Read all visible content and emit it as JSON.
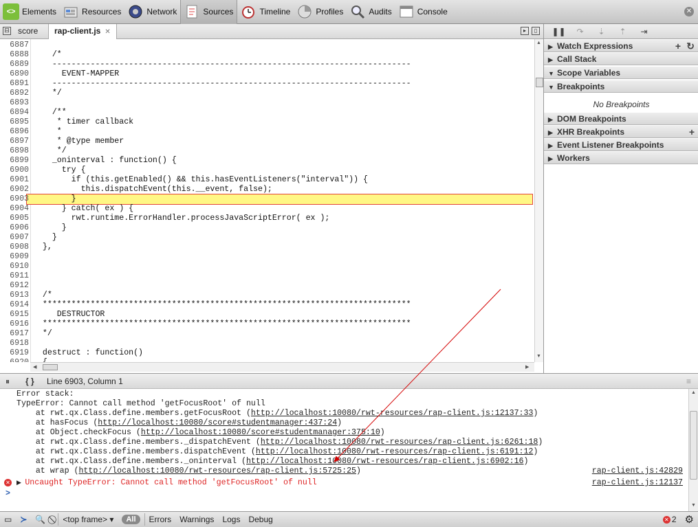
{
  "toolbar": {
    "items": [
      {
        "label": "Elements",
        "icon": "elements-icon"
      },
      {
        "label": "Resources",
        "icon": "resources-icon"
      },
      {
        "label": "Network",
        "icon": "network-icon"
      },
      {
        "label": "Sources",
        "icon": "sources-icon",
        "active": true
      },
      {
        "label": "Timeline",
        "icon": "timeline-icon"
      },
      {
        "label": "Profiles",
        "icon": "profiles-icon"
      },
      {
        "label": "Audits",
        "icon": "audits-icon"
      },
      {
        "label": "Console",
        "icon": "console-icon"
      }
    ]
  },
  "editor": {
    "tabs": [
      "score",
      "rap-client.js"
    ],
    "active_tab": "rap-client.js",
    "highlight_line": "6903",
    "lines": [
      {
        "n": "6887",
        "t": ""
      },
      {
        "n": "6888",
        "t": "    /*"
      },
      {
        "n": "6889",
        "t": "    ---------------------------------------------------------------------------"
      },
      {
        "n": "6890",
        "t": "      EVENT-MAPPER"
      },
      {
        "n": "6891",
        "t": "    ---------------------------------------------------------------------------"
      },
      {
        "n": "6892",
        "t": "    */"
      },
      {
        "n": "6893",
        "t": ""
      },
      {
        "n": "6894",
        "t": "    /**"
      },
      {
        "n": "6895",
        "t": "     * timer callback"
      },
      {
        "n": "6896",
        "t": "     *"
      },
      {
        "n": "6897",
        "t": "     * @type member"
      },
      {
        "n": "6898",
        "t": "     */"
      },
      {
        "n": "6899",
        "t": "    _oninterval : function() {"
      },
      {
        "n": "6900",
        "t": "      try {"
      },
      {
        "n": "6901",
        "t": "        if (this.getEnabled() && this.hasEventListeners(\"interval\")) {"
      },
      {
        "n": "6902",
        "t": "          this.dispatchEvent(this.__event, false);"
      },
      {
        "n": "6903",
        "t": "        }"
      },
      {
        "n": "6904",
        "t": "      } catch( ex ) {"
      },
      {
        "n": "6905",
        "t": "        rwt.runtime.ErrorHandler.processJavaScriptError( ex );"
      },
      {
        "n": "6906",
        "t": "      }"
      },
      {
        "n": "6907",
        "t": "    }"
      },
      {
        "n": "6908",
        "t": "  },"
      },
      {
        "n": "6909",
        "t": ""
      },
      {
        "n": "6910",
        "t": ""
      },
      {
        "n": "6911",
        "t": ""
      },
      {
        "n": "6912",
        "t": ""
      },
      {
        "n": "6913",
        "t": "  /*"
      },
      {
        "n": "6914",
        "t": "  *****************************************************************************"
      },
      {
        "n": "6915",
        "t": "     DESTRUCTOR"
      },
      {
        "n": "6916",
        "t": "  *****************************************************************************"
      },
      {
        "n": "6917",
        "t": "  */"
      },
      {
        "n": "6918",
        "t": ""
      },
      {
        "n": "6919",
        "t": "  destruct : function()"
      },
      {
        "n": "6920",
        "t": "  {"
      }
    ]
  },
  "sidebar": {
    "panes": [
      {
        "label": "Watch Expressions",
        "expanded": false
      },
      {
        "label": "Call Stack",
        "expanded": false
      },
      {
        "label": "Scope Variables",
        "expanded": true
      },
      {
        "label": "Breakpoints",
        "expanded": true
      },
      {
        "label": "DOM Breakpoints",
        "expanded": false
      },
      {
        "label": "XHR Breakpoints",
        "expanded": false
      },
      {
        "label": "Event Listener Breakpoints",
        "expanded": false
      },
      {
        "label": "Workers",
        "expanded": false
      }
    ],
    "no_breakpoints": "No Breakpoints"
  },
  "statusbar": {
    "position": "Line 6903, Column 1"
  },
  "console": {
    "lines": [
      {
        "text": "Error stack:"
      },
      {
        "text": "TypeError: Cannot call method 'getFocusRoot' of null"
      },
      {
        "pre": "    at rwt.qx.Class.define.members.getFocusRoot (",
        "url": "http://localhost:10080/rwt-resources/rap-client.js:12137:33",
        "post": ")"
      },
      {
        "pre": "    at hasFocus (",
        "url": "http://localhost:10080/score#studentmanager:437:24",
        "post": ")"
      },
      {
        "pre": "    at Object.checkFocus (",
        "url": "http://localhost:10080/score#studentmanager:375:10",
        "post": ")"
      },
      {
        "pre": "    at rwt.qx.Class.define.members._dispatchEvent (",
        "url": "http://localhost:10080/rwt-resources/rap-client.js:6261:18",
        "post": ")"
      },
      {
        "pre": "    at rwt.qx.Class.define.members.dispatchEvent (",
        "url": "http://localhost:10080/rwt-resources/rap-client.js:6191:12",
        "post": ")"
      },
      {
        "pre": "    at rwt.qx.Class.define.members._oninterval (",
        "url": "http://localhost:10080/rwt-resources/rap-client.js:6902:16",
        "post": ")"
      },
      {
        "pre": "    at wrap (",
        "url": "http://localhost:10080/rwt-resources/rap-client.js:5725:25",
        "post": ")",
        "source": "rap-client.js:42829"
      }
    ],
    "error": {
      "text": "Uncaught TypeError: Cannot call method 'getFocusRoot' of null",
      "source": "rap-client.js:12137"
    },
    "prompt": ">"
  },
  "bottombar": {
    "frame": "<top frame>",
    "filters": [
      "All",
      "Errors",
      "Warnings",
      "Logs",
      "Debug"
    ],
    "error_count": "2"
  }
}
